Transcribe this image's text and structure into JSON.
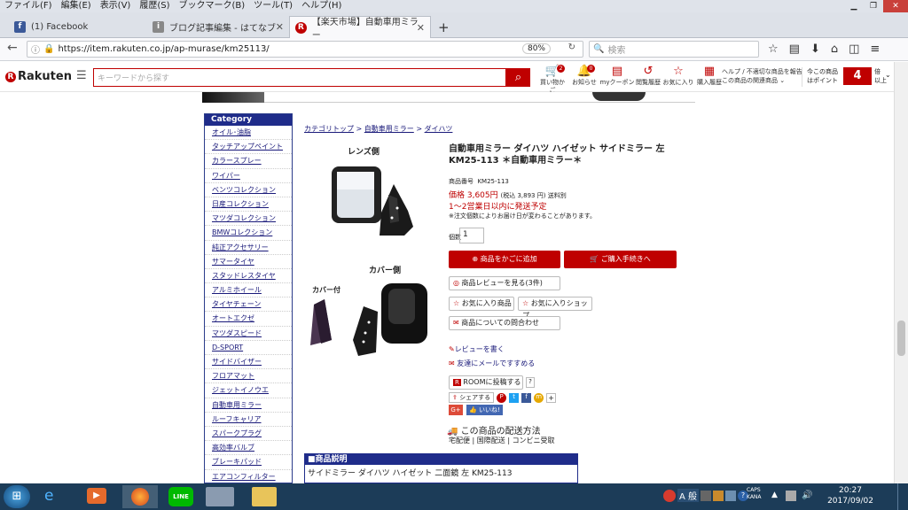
{
  "menu": [
    "ファイル(F)",
    "編集(E)",
    "表示(V)",
    "履歴(S)",
    "ブックマーク(B)",
    "ツール(T)",
    "ヘルプ(H)"
  ],
  "tabs": [
    {
      "label": "(1) Facebook",
      "color": "#3b5998",
      "glyph": "f"
    },
    {
      "label": "ブログ記事編集 - はてなブ",
      "color": "#888888",
      "glyph": "i"
    },
    {
      "label": "【楽天市場】自動車用ミラー",
      "color": "#bf0000",
      "glyph": "R"
    }
  ],
  "nav": {
    "url": "https://item.rakuten.co.jp/ap-murase/km25113/",
    "zoom": "80%",
    "search_placeholder": "検索"
  },
  "rakuten": {
    "logo": "Rakuten",
    "search_placeholder": "キーワードから探す",
    "icons": [
      {
        "label": "買い物かご",
        "glyph": "🛒",
        "badge": "2"
      },
      {
        "label": "お知らせ",
        "glyph": "🔔",
        "badge": "0"
      },
      {
        "label": "myクーポン",
        "glyph": "▤"
      },
      {
        "label": "閲覧履歴",
        "glyph": "↺"
      },
      {
        "label": "お気に入り",
        "glyph": "☆"
      },
      {
        "label": "購入履歴",
        "glyph": "▦"
      }
    ],
    "help": "ヘルプ / 不適切な商品を報告",
    "related": "この商品の関連商品",
    "points_line1": "今この商品",
    "points_line2": "はポイント",
    "points_value": "4",
    "points_unit1": "倍",
    "points_unit2": "以上"
  },
  "sidebar": {
    "title": "Category",
    "items": [
      "オイル･油脂",
      "タッチアップペイント",
      "カラースプレー",
      "ワイパー",
      "ベンツコレクション",
      "日産コレクション",
      "マツダコレクション",
      "BMWコレクション",
      "純正アクセサリー",
      "サマータイヤ",
      "スタッドレスタイヤ",
      "アルミホイール",
      "タイヤチェーン",
      "オートエクゼ",
      "マツダスピード",
      "D-SPORT",
      "サイドバイザー",
      "フロアマット",
      "ジェットイノウエ",
      "自動車用ミラー",
      "ルーフキャリア",
      "スパークプラグ",
      "高効率バルブ",
      "ブレーキパッド",
      "エアコンフィルター"
    ]
  },
  "breadcrumb": [
    "カテゴリトップ",
    "自動車用ミラー",
    "ダイハツ"
  ],
  "images": {
    "lens_label": "レンズ側",
    "cover_label": "カバー側",
    "cover_attached": "カバー付"
  },
  "product": {
    "title": "自動車用ミラー ダイハツ ハイゼット サイドミラー 左 KM25-113 ＊自動車用ミラー＊",
    "id_label": "商品番号",
    "id_value": "KM25-113",
    "price": "価格 3,605円",
    "price_tax": "(税込 3,893 円) 送料別",
    "ship": "1〜2営業日以内に発送予定",
    "ship_note": "※注文個数によりお届け日が変わることがあります。",
    "qty_label": "個数",
    "qty_value": "1",
    "cart_button": "商品をかごに追加",
    "checkout_button": "ご購入手続きへ",
    "review_button": "商品レビューを見る(3件)",
    "fav_item": "お気に入り商品",
    "fav_shop": "お気に入りショップ",
    "inquiry": "商品についての問合わせ",
    "write_review": "レビューを書く",
    "mail_friend": "友達にメールですすめる",
    "room": "ROOMに投稿する",
    "room_q": "?",
    "share": "シェアする",
    "like": "いいね!",
    "delivery_title": "この商品の配送方法",
    "delivery_methods": [
      "宅配便",
      "国際配送",
      "コンビニ受取"
    ]
  },
  "description": {
    "header": "■商品説明",
    "body": "サイドミラー ダイハツ ハイゼット 二面鏡 左 KM25-113"
  },
  "taskbar": {
    "time": "20:27",
    "date": "2017/09/02",
    "ime": "A 般",
    "caps": "CAPS",
    "kana": "KANA"
  }
}
